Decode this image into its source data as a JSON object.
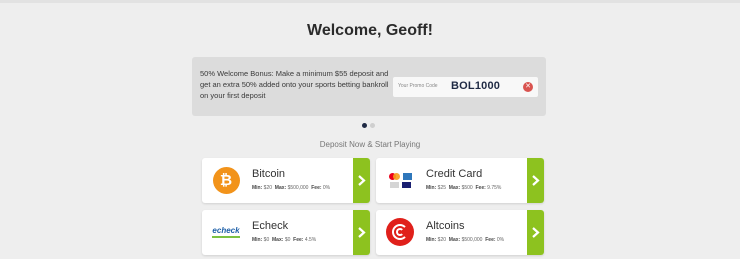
{
  "header": {
    "title": "Welcome, Geoff!"
  },
  "promo": {
    "text": "50% Welcome Bonus: Make a minimum $55 deposit and get an extra 50% added onto your sports betting bankroll on your first deposit",
    "field_label": "Your Promo Code",
    "code": "BOL1000",
    "clear_icon": "clear-icon"
  },
  "carousel": {
    "total": 2,
    "active": 1
  },
  "section": {
    "subtitle": "Deposit Now & Start Playing"
  },
  "colors": {
    "accent": "#8dc21f",
    "bitcoin": "#f2931a",
    "altcoin": "#e0201b",
    "clear": "#d9534f"
  },
  "methods": [
    {
      "name": "Bitcoin",
      "min_label": "Min:",
      "min": "$20",
      "max_label": "Max:",
      "max": "$500,000",
      "fee_label": "Fee:",
      "fee": "0%",
      "icon": "bitcoin-icon"
    },
    {
      "name": "Credit Card",
      "min_label": "Min:",
      "min": "$25",
      "max_label": "Max:",
      "max": "$500",
      "fee_label": "Fee:",
      "fee": "9.75%",
      "icon": "credit-card-icon"
    },
    {
      "name": "Echeck",
      "min_label": "Min:",
      "min": "$0",
      "max_label": "Max:",
      "max": "$0",
      "fee_label": "Fee:",
      "fee": "4.5%",
      "icon": "echeck-icon",
      "logo_text": "echeck"
    },
    {
      "name": "Altcoins",
      "min_label": "Min:",
      "min": "$20",
      "max_label": "Max:",
      "max": "$500,000",
      "fee_label": "Fee:",
      "fee": "0%",
      "icon": "altcoin-icon"
    }
  ]
}
